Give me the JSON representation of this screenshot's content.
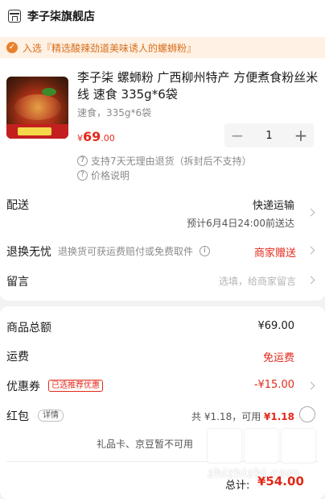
{
  "store": {
    "name": "李子柒旗舰店",
    "icon": "store-icon"
  },
  "promo": {
    "text": "入选『精选酸辣劲道美味诱人的螺蛳粉』",
    "icon": "award-icon",
    "color": "#e8812c"
  },
  "product": {
    "title": "李子柒 螺蛳粉 广西柳州特产 方便煮食粉丝米线 速食 335g*6袋",
    "spec": "速食，335g*6袋",
    "price_currency": "¥",
    "price_int": "69",
    "price_dec": ".00",
    "quantity": "1",
    "minus": "−",
    "plus": "+",
    "service_1": "支持7天无理由退货（拆封后不支持）",
    "service_1_icon": "7",
    "service_2": "价格说明",
    "service_2_icon": "?"
  },
  "shipping": {
    "label": "配送",
    "method": "快递运输",
    "eta": "预计6月4日24:00前送达"
  },
  "returns": {
    "label": "退换无忧",
    "desc": "退换货可获运费赔付或免费取件",
    "info_icon": "i",
    "value": "商家赠送"
  },
  "message": {
    "label": "留言",
    "placeholder": "选填，给商家留言"
  },
  "summary": {
    "goods_total_label": "商品总额",
    "goods_total": "¥69.00",
    "freight_label": "运费",
    "freight": "免运费",
    "coupon_label": "优惠券",
    "coupon_badge": "已选推荐优惠",
    "coupon": "-¥15.00",
    "redpack_label": "红包",
    "redpack_badge": "详情",
    "redpack_total": "共 ¥1.18，可用",
    "redpack_avail": "¥1.18",
    "giftcard_note": "礼品卡、京豆暂不可用",
    "total_label": "总计:",
    "total": "¥54.00"
  },
  "watermark": {
    "text": "zhizhizhi.com"
  },
  "colors": {
    "accent": "#e3291a",
    "promo_bg": "#fff1e3"
  }
}
